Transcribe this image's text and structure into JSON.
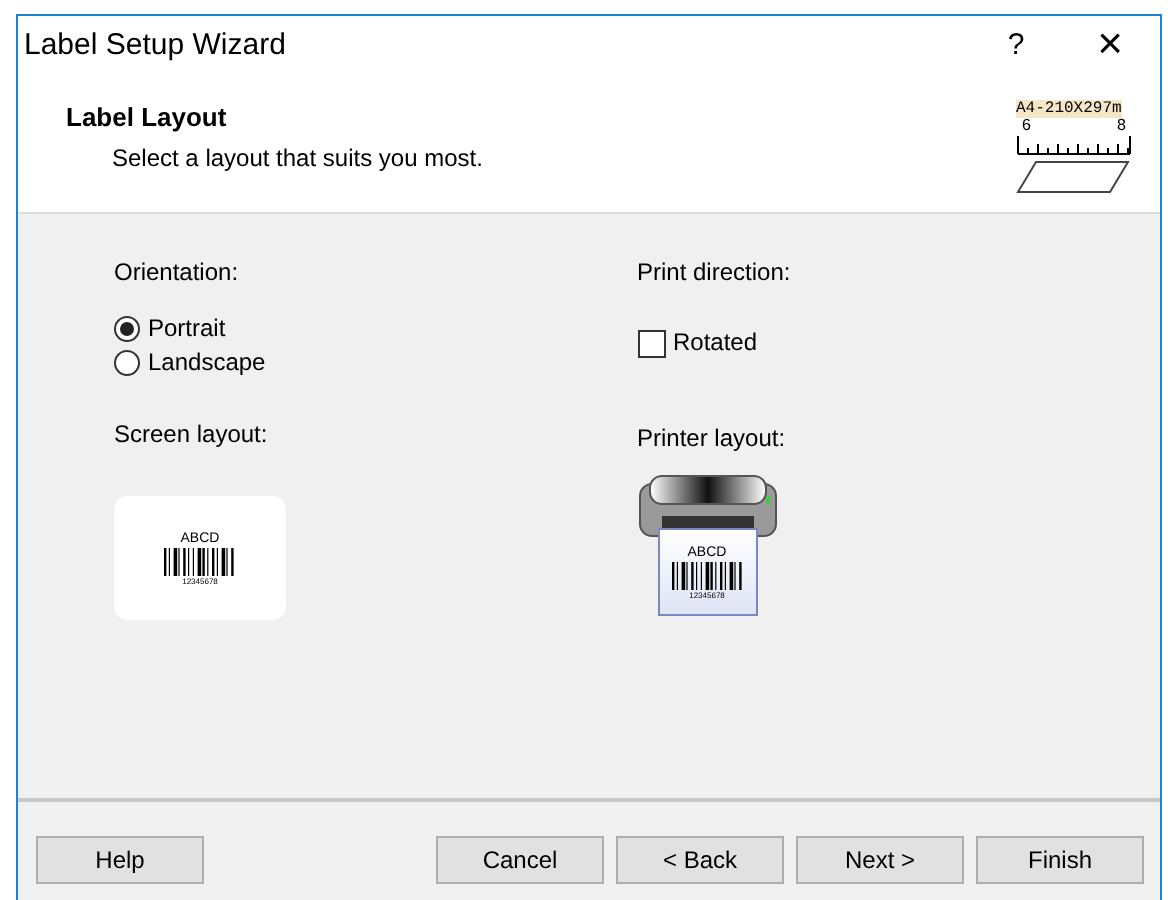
{
  "window": {
    "title": "Label Setup Wizard",
    "help": "?",
    "close": "×"
  },
  "header": {
    "title": "Label Layout",
    "subtitle": "Select a layout that suits you most.",
    "paper_size": "A4-210X297m",
    "ruler_marks": [
      "6",
      "8"
    ]
  },
  "orientation": {
    "label": "Orientation:",
    "options": [
      {
        "label": "Portrait",
        "selected": true
      },
      {
        "label": "Landscape",
        "selected": false
      }
    ]
  },
  "print_direction": {
    "label": "Print direction:",
    "rotated": {
      "label": "Rotated",
      "checked": false
    }
  },
  "screen_layout": {
    "label": "Screen layout:",
    "sample_text": "ABCD",
    "sample_number": "12345678"
  },
  "printer_layout": {
    "label": "Printer layout:",
    "sample_text": "ABCD",
    "sample_number": "12345678"
  },
  "buttons": [
    {
      "label": "Help",
      "kind": "left"
    },
    {
      "label": "Cancel",
      "kind": "right"
    },
    {
      "label": "< Back",
      "kind": "right"
    },
    {
      "label": "Next >",
      "kind": "right"
    },
    {
      "label": "Finish",
      "kind": "right"
    }
  ]
}
